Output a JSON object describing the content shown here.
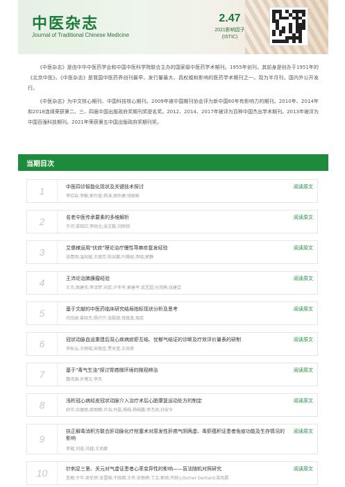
{
  "header": {
    "title": "中医杂志",
    "subtitle": "Journal of Traditional Chinese Medicine",
    "impact_value": "2.47",
    "impact_label": "2021影响因子",
    "impact_source": "(ISTIC)"
  },
  "intro": {
    "p1": "《中医杂志》是由中华中医药学会和中国中医科学院联合主办的国家级中医药学术期刊。1955年创刊，其前身是创办于1951年的《北京中医》。《中医杂志》是我国中医药界创刊最早、发行量最大、具权威和影响的医药学术期刊之一。现为半月刊，国内外公开发行。",
    "p2": "《中医杂志》为中文核心期刊、中国科技核心期刊。2009年被中国期刊协会评为新中国60年有影响力的期刊。2010年、2014年和2018连续荣获第二、三、四届中国出版政府奖期刊奖提名奖。2012、2014、2017年被评为百种中国杰出学术期刊。2013年被评为中国百强科技期刊。2021年荣获第五中国出版政府奖期刊奖。"
  },
  "section": {
    "title": "当期目次"
  },
  "read_label": "阅读原文",
  "articles": [
    {
      "num": "1",
      "title": "中医四诊智能化现状及关键技术探讨",
      "authors": "李红岩;李敏;郭许瑄;杨涛;周作建;钱丽彬"
    },
    {
      "num": "2",
      "title": "名老中医传承要素的多维解析",
      "authors": "于河;苗晓红;李刚尤;张文数;刘映钥"
    },
    {
      "num": "3",
      "title": "艾儒棣运用\"伏痰\"理论治疗慢性荨麻疹复发经验",
      "authors": "张青明;温尚斌;王丽芳;陈安鹏;叶腾如;李晓;郭静"
    },
    {
      "num": "4",
      "title": "王沛论治脾胰瘤经验",
      "authors": "王杰;周建伟;李诗梦;刘蕊;卢冬冬;郭善平;武艺超;付月鹃;张建芸"
    },
    {
      "num": "5",
      "title": "基于文献的中医药临床研究结局指标现状分析及思考",
      "authors": "代欣颖;曾晓杰;杨巧宁;张殿观;钱真真;周蕊"
    },
    {
      "num": "6",
      "title": "冠状动脉血运重建后双心疾病痰瘀互结、忧郁气结证的诊断及疗效评价量表的研制",
      "authors": "李秋云;王雨瑶;宋丽佳;贾天莹;王凤荣"
    },
    {
      "num": "7",
      "title": "基于\"毒气生浊\"探讨胃癌微环境的微观辨治",
      "authors": "魏鸿渊;许博文;李杰"
    },
    {
      "num": "8",
      "title": "浅析冠心病经皮冠状动脉介入治疗术后心脏康复运动处方的制定",
      "authors": "舒华;余娜丽;邵丽静;许滔;丹晶;杨皓;杨皓鹏;李杰凤;孙安令"
    },
    {
      "num": "9",
      "title": "扶正解毒消积方联合肝动脉化疗栓塞术对原发性肝癌气阴两虚、毒瘀蕴积证患者免疫功能及生存情况的影响",
      "authors": "李斌;刘遥;冯越;王凤娜"
    },
    {
      "num": "10",
      "title": "针刺足三里、关元对气虚证患者心率变异性的影响——盲法随机对照研究",
      "authors": "连根;于华;吴伦然;张雪国;于晓婧;王传;安丽婷;丁文;郭琦;乔顾;Litscher Gerhard;梁凤霞"
    }
  ]
}
